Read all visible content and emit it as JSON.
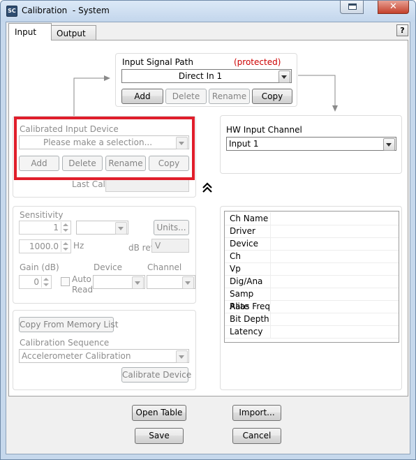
{
  "window": {
    "title": "Calibration  - System",
    "close_glyph": "✕",
    "icon_label": "SC"
  },
  "tabs": [
    {
      "label": "Input",
      "active": true
    },
    {
      "label": "Output",
      "active": false
    }
  ],
  "help_label": "?",
  "input_signal_path": {
    "label": "Input Signal Path",
    "protected_label": "(protected)",
    "selected": "Direct In 1",
    "buttons": {
      "add": "Add",
      "delete": "Delete",
      "rename": "Rename",
      "copy": "Copy"
    }
  },
  "calibrated_input_device": {
    "label": "Calibrated Input Device",
    "placeholder": "Please make a selection...",
    "buttons": {
      "add": "Add",
      "delete": "Delete",
      "rename": "Rename",
      "copy": "Copy"
    },
    "last_cal_label": "Last Cal.",
    "last_cal_value": ""
  },
  "hw_input_channel": {
    "label": "HW Input Channel",
    "selected": "Input 1"
  },
  "collapse_glyph": "⌃",
  "sensitivity": {
    "label": "Sensitivity",
    "value": "1",
    "unit_selected": "",
    "units_button": "Units...",
    "ref_value": "1000.0",
    "hz_label": "Hz",
    "db_ref_label": "dB ref",
    "db_ref_value": "V"
  },
  "gain": {
    "label": "Gain (dB)",
    "value": "0",
    "auto_read_label_1": "Auto",
    "auto_read_label_2": "Read",
    "device_label": "Device",
    "channel_label": "Channel"
  },
  "memory": {
    "copy_button": "Copy From Memory List",
    "sequence_label": "Calibration Sequence",
    "sequence_selected": "Accelerometer Calibration",
    "calibrate_button": "Calibrate Device"
  },
  "channel_info": {
    "rows": [
      {
        "key": "Ch Name",
        "value": ""
      },
      {
        "key": "Driver",
        "value": ""
      },
      {
        "key": "Device",
        "value": ""
      },
      {
        "key": "Ch",
        "value": ""
      },
      {
        "key": "Vp",
        "value": ""
      },
      {
        "key": "Dig/Ana",
        "value": ""
      },
      {
        "key": "Samp Rate",
        "value": ""
      },
      {
        "key": "Alias Freq",
        "value": ""
      },
      {
        "key": "Bit Depth",
        "value": ""
      },
      {
        "key": "Latency",
        "value": ""
      }
    ]
  },
  "footer": {
    "open_table": "Open Table",
    "import": "Import...",
    "save": "Save",
    "cancel": "Cancel"
  },
  "colors": {
    "highlight_box": "#e01e2b",
    "protected_text": "#cc0000",
    "title_bar": "#c6d8ec",
    "close_button": "#c4412c"
  }
}
